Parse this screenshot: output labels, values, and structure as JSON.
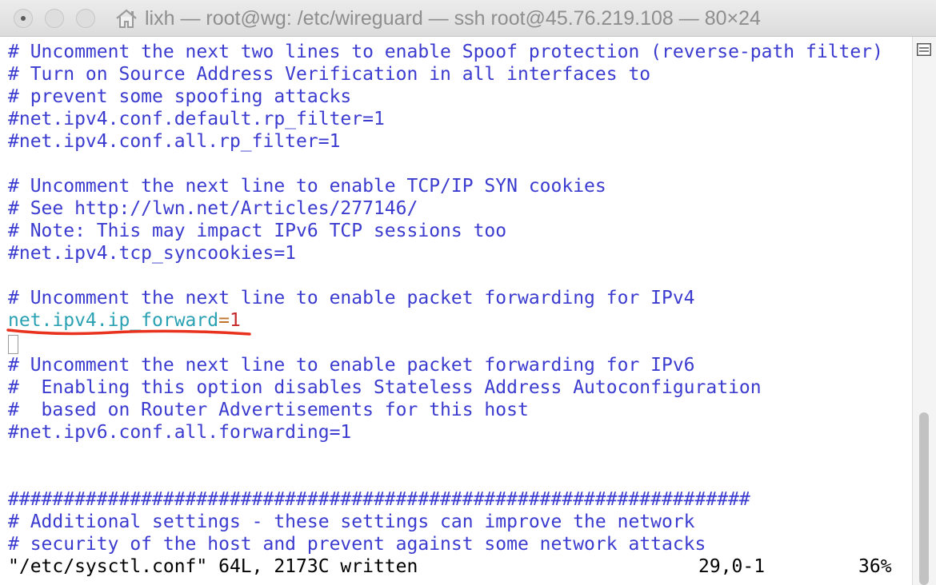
{
  "window": {
    "title": "lixh — root@wg: /etc/wireguard — ssh root@45.76.219.108 — 80×24"
  },
  "terminal": {
    "lines": [
      "# Uncomment the next two lines to enable Spoof protection (reverse-path filter)",
      "# Turn on Source Address Verification in all interfaces to",
      "# prevent some spoofing attacks",
      "#net.ipv4.conf.default.rp_filter=1",
      "#net.ipv4.conf.all.rp_filter=1",
      "",
      "# Uncomment the next line to enable TCP/IP SYN cookies",
      "# See http://lwn.net/Articles/277146/",
      "# Note: This may impact IPv6 TCP sessions too",
      "#net.ipv4.tcp_syncookies=1",
      "",
      "# Uncomment the next line to enable packet forwarding for IPv4"
    ],
    "active_setting": {
      "key": "net.ipv4.ip_forward",
      "equals": "=",
      "value": "1"
    },
    "lines_after": [
      "# Uncomment the next line to enable packet forwarding for IPv6",
      "#  Enabling this option disables Stateless Address Autoconfiguration",
      "#  based on Router Advertisements for this host",
      "#net.ipv6.conf.all.forwarding=1",
      "",
      "",
      "###################################################################",
      "# Additional settings - these settings can improve the network",
      "# security of the host and prevent against some network attacks"
    ],
    "status": {
      "message": "\"/etc/sysctl.conf\" 64L, 2173C written",
      "position": "29,0-1",
      "percent": "36%"
    }
  },
  "colors": {
    "comment": "#3b3bd0",
    "key": "#2aa1b3",
    "operator": "#c0722a",
    "value": "#c62828",
    "annotation": "#e8321e"
  },
  "icons": [
    "home-icon",
    "scroll-lines-icon"
  ]
}
